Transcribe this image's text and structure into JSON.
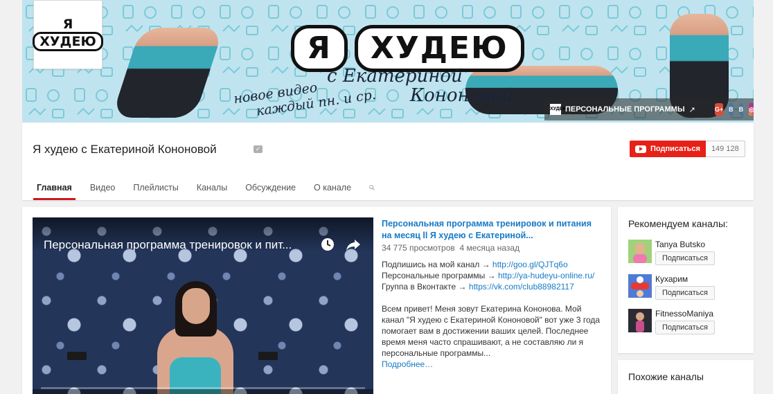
{
  "banner": {
    "avatar_lines": [
      "Я",
      "ХУДЕЮ"
    ],
    "title_words": [
      "Я",
      "ХУДЕЮ"
    ],
    "subtitle_lines": [
      "с Екатериной",
      "Кононовой"
    ],
    "tagline_lines": [
      "новое видео",
      "каждый пн. и ср."
    ],
    "links_label": "ПЕРСОНАЛЬНЫЕ ПРОГРАММЫ",
    "links_mini_logo": "ХУДЕЮ",
    "social": [
      "G+",
      "B",
      "B",
      "◎"
    ]
  },
  "header": {
    "channel_title": "Я худею с Екатериной Кононовой",
    "subscribe_label": "Подписаться",
    "subscriber_count": "149 128",
    "tabs": [
      "Главная",
      "Видео",
      "Плейлисты",
      "Каналы",
      "Обсуждение",
      "О канале"
    ]
  },
  "featured": {
    "player_title": "Персональная программа тренировок и пит...",
    "video_title": "Персональная программа тренировок и питания на месяц ll Я худею с Екатериной...",
    "views": "34 775 просмотров",
    "age": "4 месяца назад",
    "desc_line1_text": "Подпишись на мой канал → ",
    "desc_line1_link": "http://goo.gl/QJTq6o",
    "desc_line2_text": "Персональные программы → ",
    "desc_line2_link": "http://ya-hudeyu-online.ru/",
    "desc_line3_text": "Группа в Вконтакте → ",
    "desc_line3_link": "https://vk.com/club88982117",
    "desc_para": "Всем привет! Меня зовут Екатерина Кононова. Мой канал \"Я худею с Екатериной Кононовой\" вот уже 3 года помогает вам в достижении ваших целей. Последнее время меня часто спрашивают, а не составляю ли я персональные программы...",
    "more_label": "Подробнее…"
  },
  "sidebar": {
    "recommended_title": "Рекомендуем каналы:",
    "channels": [
      {
        "name": "Tanya Butsko",
        "button": "Подписаться"
      },
      {
        "name": "Кухарим",
        "button": "Подписаться"
      },
      {
        "name": "FitnessoManiya",
        "button": "Подписаться"
      }
    ],
    "similar_title": "Похожие каналы"
  },
  "colors": {
    "accent_red": "#e62117",
    "link_blue": "#167ac6",
    "banner_bg": "#bfe4ef"
  }
}
